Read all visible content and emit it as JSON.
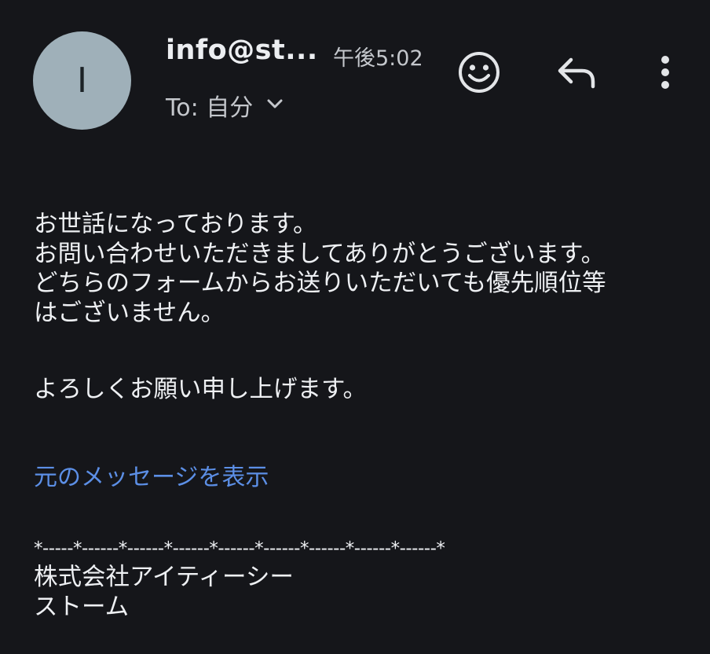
{
  "header": {
    "avatar_letter": "I",
    "sender": "info@st...",
    "time": "午後5:02",
    "to_label": "To: 自分",
    "icons": {
      "emoji": "emoji-smile-icon",
      "reply": "reply-arrow-icon",
      "more": "more-vert-icon",
      "expand": "chevron-down-icon"
    }
  },
  "body": {
    "lines": [
      "お世話になっております。",
      "お問い合わせいただきましてありがとうございます。",
      "どちらのフォームからお送りいただいても優先順位等",
      "はございません。"
    ],
    "closing": "よろしくお願い申し上げます。"
  },
  "show_original_link": "元のメッセージを表示",
  "signature": {
    "separator": "*-----*------*------*------*------*------*------*------*------*",
    "company_line1": "株式会社アイティーシー",
    "company_line2": "ストーム"
  },
  "colors": {
    "background": "#15161a",
    "avatar": "#9fb0b9",
    "link": "#5c8fe6",
    "text": "#eef0f3",
    "secondary_text": "#c4c7cc"
  }
}
